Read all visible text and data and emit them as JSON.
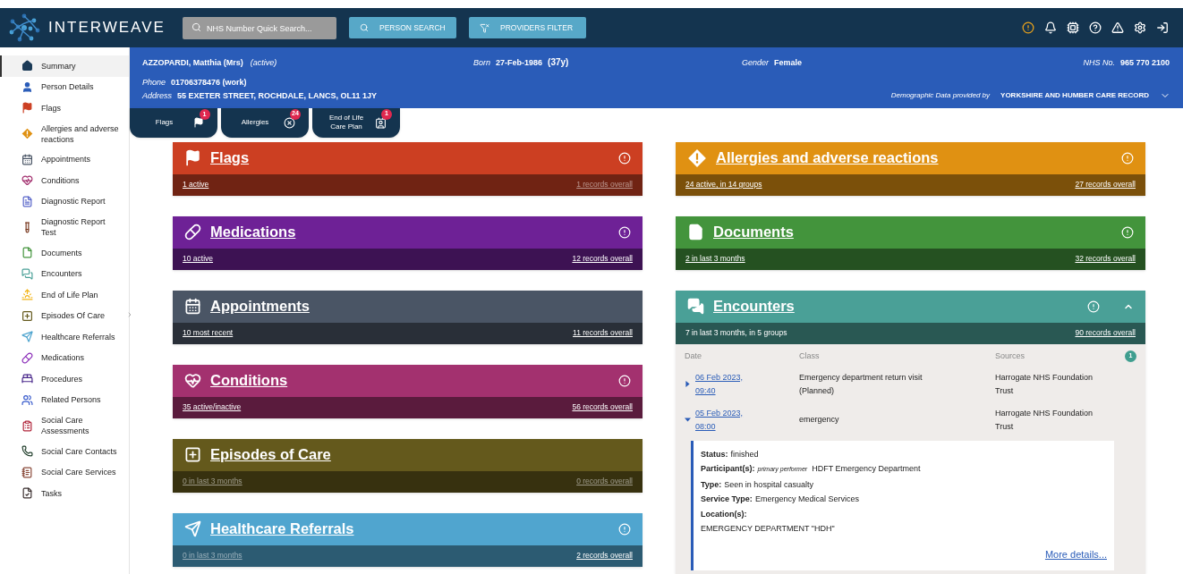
{
  "header": {
    "brand": "INTERWEAVE",
    "search": {
      "placeholder": "NHS Number Quick Search..."
    },
    "buttons": [
      "PERSON SEARCH",
      "PROVIDERS FILTER"
    ]
  },
  "sidebar": {
    "items": [
      {
        "label": "Summary",
        "selected": true
      },
      {
        "label": "Person Details",
        "selected": false
      },
      {
        "label": "Flags",
        "selected": false
      },
      {
        "label": "Allergies and adverse reactions",
        "selected": false
      },
      {
        "label": "Appointments",
        "selected": false
      },
      {
        "label": "Conditions",
        "selected": false
      },
      {
        "label": "Diagnostic Report",
        "selected": false
      },
      {
        "label": "Diagnostic Report Test",
        "selected": false
      },
      {
        "label": "Documents",
        "selected": false
      },
      {
        "label": "Encounters",
        "selected": false
      },
      {
        "label": "End of Life Plan",
        "selected": false
      },
      {
        "label": "Episodes Of Care",
        "selected": false
      },
      {
        "label": "Healthcare Referrals",
        "selected": false
      },
      {
        "label": "Medications",
        "selected": false
      },
      {
        "label": "Procedures",
        "selected": false
      },
      {
        "label": "Related Persons",
        "selected": false
      },
      {
        "label": "Social Care Assessments",
        "selected": false
      },
      {
        "label": "Social Care Contacts",
        "selected": false
      },
      {
        "label": "Social Care Services",
        "selected": false
      },
      {
        "label": "Tasks",
        "selected": false
      }
    ]
  },
  "patient": {
    "name": "AZZOPARDI, Matthia (Mrs)",
    "status": "(active)",
    "born_label": "Born",
    "born": "27-Feb-1986",
    "age": "(37y)",
    "gender_label": "Gender",
    "gender": "Female",
    "nhs_label": "NHS No.",
    "nhs": "965 770 2100",
    "phone_label": "Phone",
    "phone": "01706378476 (work)",
    "address_label": "Address",
    "address": "55 EXETER STREET, ROCHDALE, LANCS, OL11 1JY",
    "provider_label": "Demographic Data provided by",
    "provider": "YORKSHIRE AND HUMBER CARE RECORD"
  },
  "quick_tabs": [
    {
      "label": "Flags",
      "badge": "1"
    },
    {
      "label": "Allergies",
      "badge": "24"
    },
    {
      "label": "End of Life Care Plan",
      "badge": "1"
    }
  ],
  "cards_left": [
    {
      "kind": "flags",
      "title": "Flags",
      "color": "#cc3f22",
      "alert": true,
      "summary": {
        "text": "1 active",
        "dim": false,
        "link": true
      },
      "total": {
        "text": "1 records overall",
        "dim": true
      }
    },
    {
      "kind": "medications",
      "title": "Medications",
      "color": "#6e2196",
      "alert": true,
      "summary": {
        "text": "10 active",
        "dim": false,
        "link": true
      },
      "total": {
        "text": "12 records overall",
        "dim": false
      }
    },
    {
      "kind": "appointments",
      "title": "Appointments",
      "color": "#4a5565",
      "alert": false,
      "summary": {
        "text": "10 most recent",
        "dim": false,
        "link": true
      },
      "total": {
        "text": "11 records overall",
        "dim": false
      }
    },
    {
      "kind": "conditions",
      "title": "Conditions",
      "color": "#a3316f",
      "alert": true,
      "summary": {
        "text": "35 active/inactive",
        "dim": false,
        "link": true
      },
      "total": {
        "text": "56 records overall",
        "dim": false
      }
    },
    {
      "kind": "episodes",
      "title": "Episodes of Care",
      "color": "#64591c",
      "alert": false,
      "summary": {
        "text": "0 in last 3 months",
        "dim": true,
        "link": true
      },
      "total": {
        "text": "0 records overall",
        "dim": true
      }
    },
    {
      "kind": "referrals",
      "title": "Healthcare Referrals",
      "color": "#50a5cf",
      "alert": true,
      "summary": {
        "text": "0 in last 3 months",
        "dim": true,
        "link": true
      },
      "total": {
        "text": "2 records overall",
        "dim": false
      }
    }
  ],
  "cards_right": [
    {
      "kind": "allergies",
      "title": "Allergies and adverse reactions",
      "color": "#e09112",
      "alert": true,
      "summary": {
        "text": "24 active, in 14 groups",
        "dim": false,
        "link": true
      },
      "total": {
        "text": "27 records overall",
        "dim": false
      }
    },
    {
      "kind": "documents",
      "title": "Documents",
      "color": "#43943c",
      "alert": true,
      "summary": {
        "text": "2 in last 3 months",
        "dim": false,
        "link": true
      },
      "total": {
        "text": "32 records overall",
        "dim": false
      }
    },
    {
      "kind": "encounters",
      "title": "Encounters",
      "color": "#4aa097",
      "alert": true,
      "expanded": true,
      "summary": {
        "text": "7 in last 3 months, in 5 groups",
        "dim": false,
        "link": false
      },
      "total": {
        "text": "90 records overall",
        "dim": false
      },
      "table": {
        "columns": [
          "Date",
          "Class",
          "Sources"
        ],
        "count_badge": "1",
        "rows": [
          {
            "date": "06 Feb 2023, 09:40",
            "class": "Emergency department return visit (Planned)",
            "source": "Harrogate NHS Foundation Trust",
            "expanded": false
          },
          {
            "date": "05 Feb 2023, 08:00",
            "class": "emergency",
            "source": "Harrogate NHS Foundation Trust",
            "expanded": true,
            "details": {
              "fields": [
                {
                  "kind": "inline",
                  "label": "Status:",
                  "value": "finished"
                },
                {
                  "kind": "inline",
                  "label": "Participant(s):",
                  "role": "primary performer",
                  "value": "HDFT Emergency Department"
                },
                {
                  "kind": "inline",
                  "label": "Type:",
                  "value": "Seen in hospital casualty"
                },
                {
                  "kind": "inline",
                  "label": "Service Type:",
                  "value": "Emergency Medical Services"
                },
                {
                  "kind": "stacked",
                  "label": "Location(s):",
                  "value": "EMERGENCY DEPARTMENT \"HDH\""
                }
              ],
              "more_link": "More details..."
            }
          }
        ]
      }
    }
  ]
}
